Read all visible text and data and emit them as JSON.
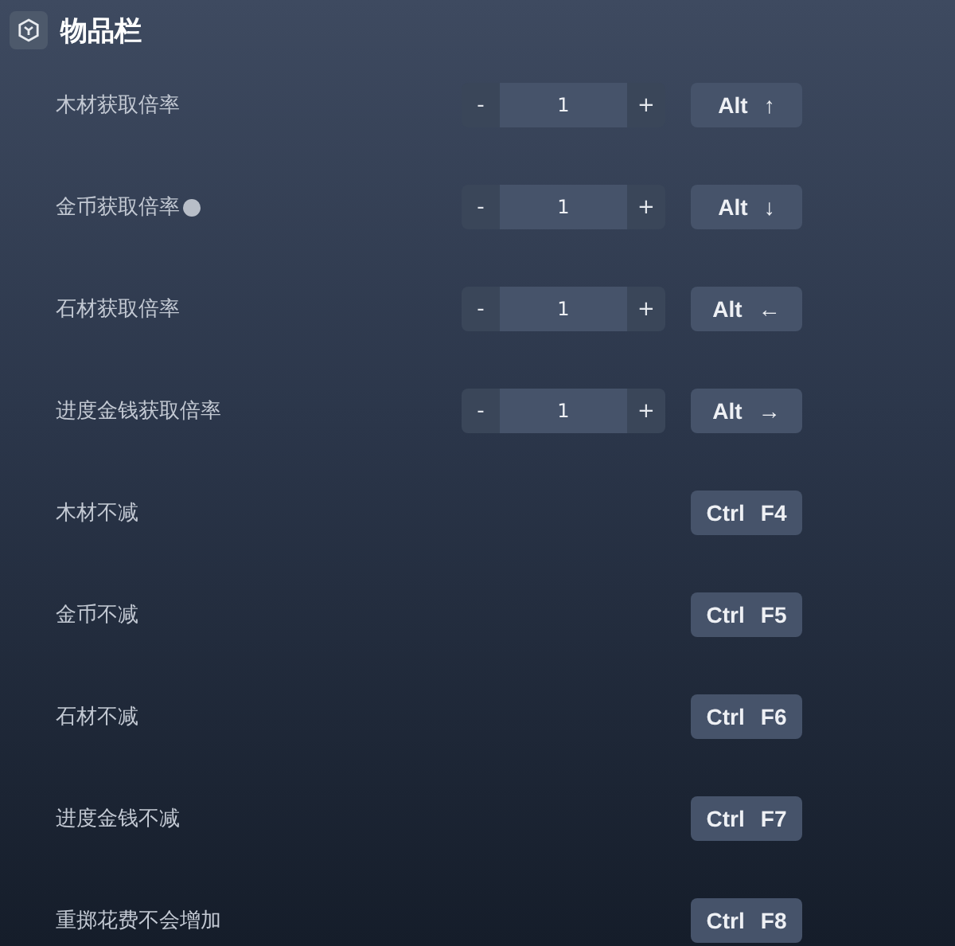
{
  "section": {
    "title": "物品栏"
  },
  "rows": [
    {
      "kind": "stepper",
      "label": "木材获取倍率",
      "help": false,
      "value": "1",
      "minus": "-",
      "plus": "+",
      "modifier": "Alt",
      "key": "↑"
    },
    {
      "kind": "stepper",
      "label": "金币获取倍率",
      "help": true,
      "value": "1",
      "minus": "-",
      "plus": "+",
      "modifier": "Alt",
      "key": "↓"
    },
    {
      "kind": "stepper",
      "label": "石材获取倍率",
      "help": false,
      "value": "1",
      "minus": "-",
      "plus": "+",
      "modifier": "Alt",
      "key": "←"
    },
    {
      "kind": "stepper",
      "label": "进度金钱获取倍率",
      "help": false,
      "value": "1",
      "minus": "-",
      "plus": "+",
      "modifier": "Alt",
      "key": "→"
    },
    {
      "kind": "toggle",
      "label": "木材不减",
      "help": false,
      "modifier": "Ctrl",
      "key": "F4"
    },
    {
      "kind": "toggle",
      "label": "金币不减",
      "help": false,
      "modifier": "Ctrl",
      "key": "F5"
    },
    {
      "kind": "toggle",
      "label": "石材不减",
      "help": false,
      "modifier": "Ctrl",
      "key": "F6"
    },
    {
      "kind": "toggle",
      "label": "进度金钱不减",
      "help": false,
      "modifier": "Ctrl",
      "key": "F7"
    },
    {
      "kind": "toggle",
      "label": "重掷花费不会增加",
      "help": false,
      "modifier": "Ctrl",
      "key": "F8"
    }
  ]
}
